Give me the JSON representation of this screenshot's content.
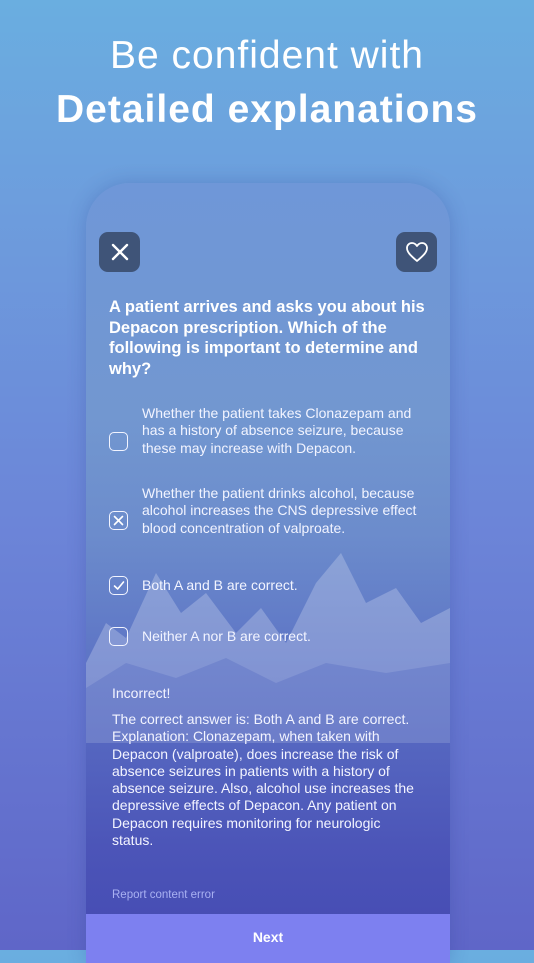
{
  "headline": {
    "line1": "Be confident with",
    "line2": "Detailed explanations"
  },
  "icons": {
    "close": "close-icon",
    "favorite": "heart-icon",
    "wrong": "x-mark-icon",
    "right": "check-mark-icon"
  },
  "question": {
    "text": "A patient arrives and asks you about his Depacon prescription. Which of the following is important to determine and why?",
    "options": [
      {
        "text": "Whether the patient takes Clonazepam and has a history of absence seizure, because these may increase with Depacon.",
        "state": "empty"
      },
      {
        "text": "Whether the patient drinks alcohol, because alcohol increases the CNS depressive effect blood concentration of valproate.",
        "state": "wrong"
      },
      {
        "text": "Both A and B are correct.",
        "state": "correct"
      },
      {
        "text": "Neither A nor B are correct.",
        "state": "empty"
      }
    ]
  },
  "feedback": {
    "title": "Incorrect!",
    "body": "The correct answer is: Both A and B are correct.\nExplanation:  Clonazepam, when taken with Depacon (valproate), does increase the risk of absence seizures in patients with a history of absence seizure. Also, alcohol use increases the depressive effects of Depacon. Any patient on Depacon requires monitoring for neurologic status."
  },
  "report_label": "Report content error",
  "next_label": "Next",
  "colors": {
    "accent_button": "#7d80f0",
    "icon_button_bg": "#3f5478",
    "report_link": "#a9b1f2"
  }
}
